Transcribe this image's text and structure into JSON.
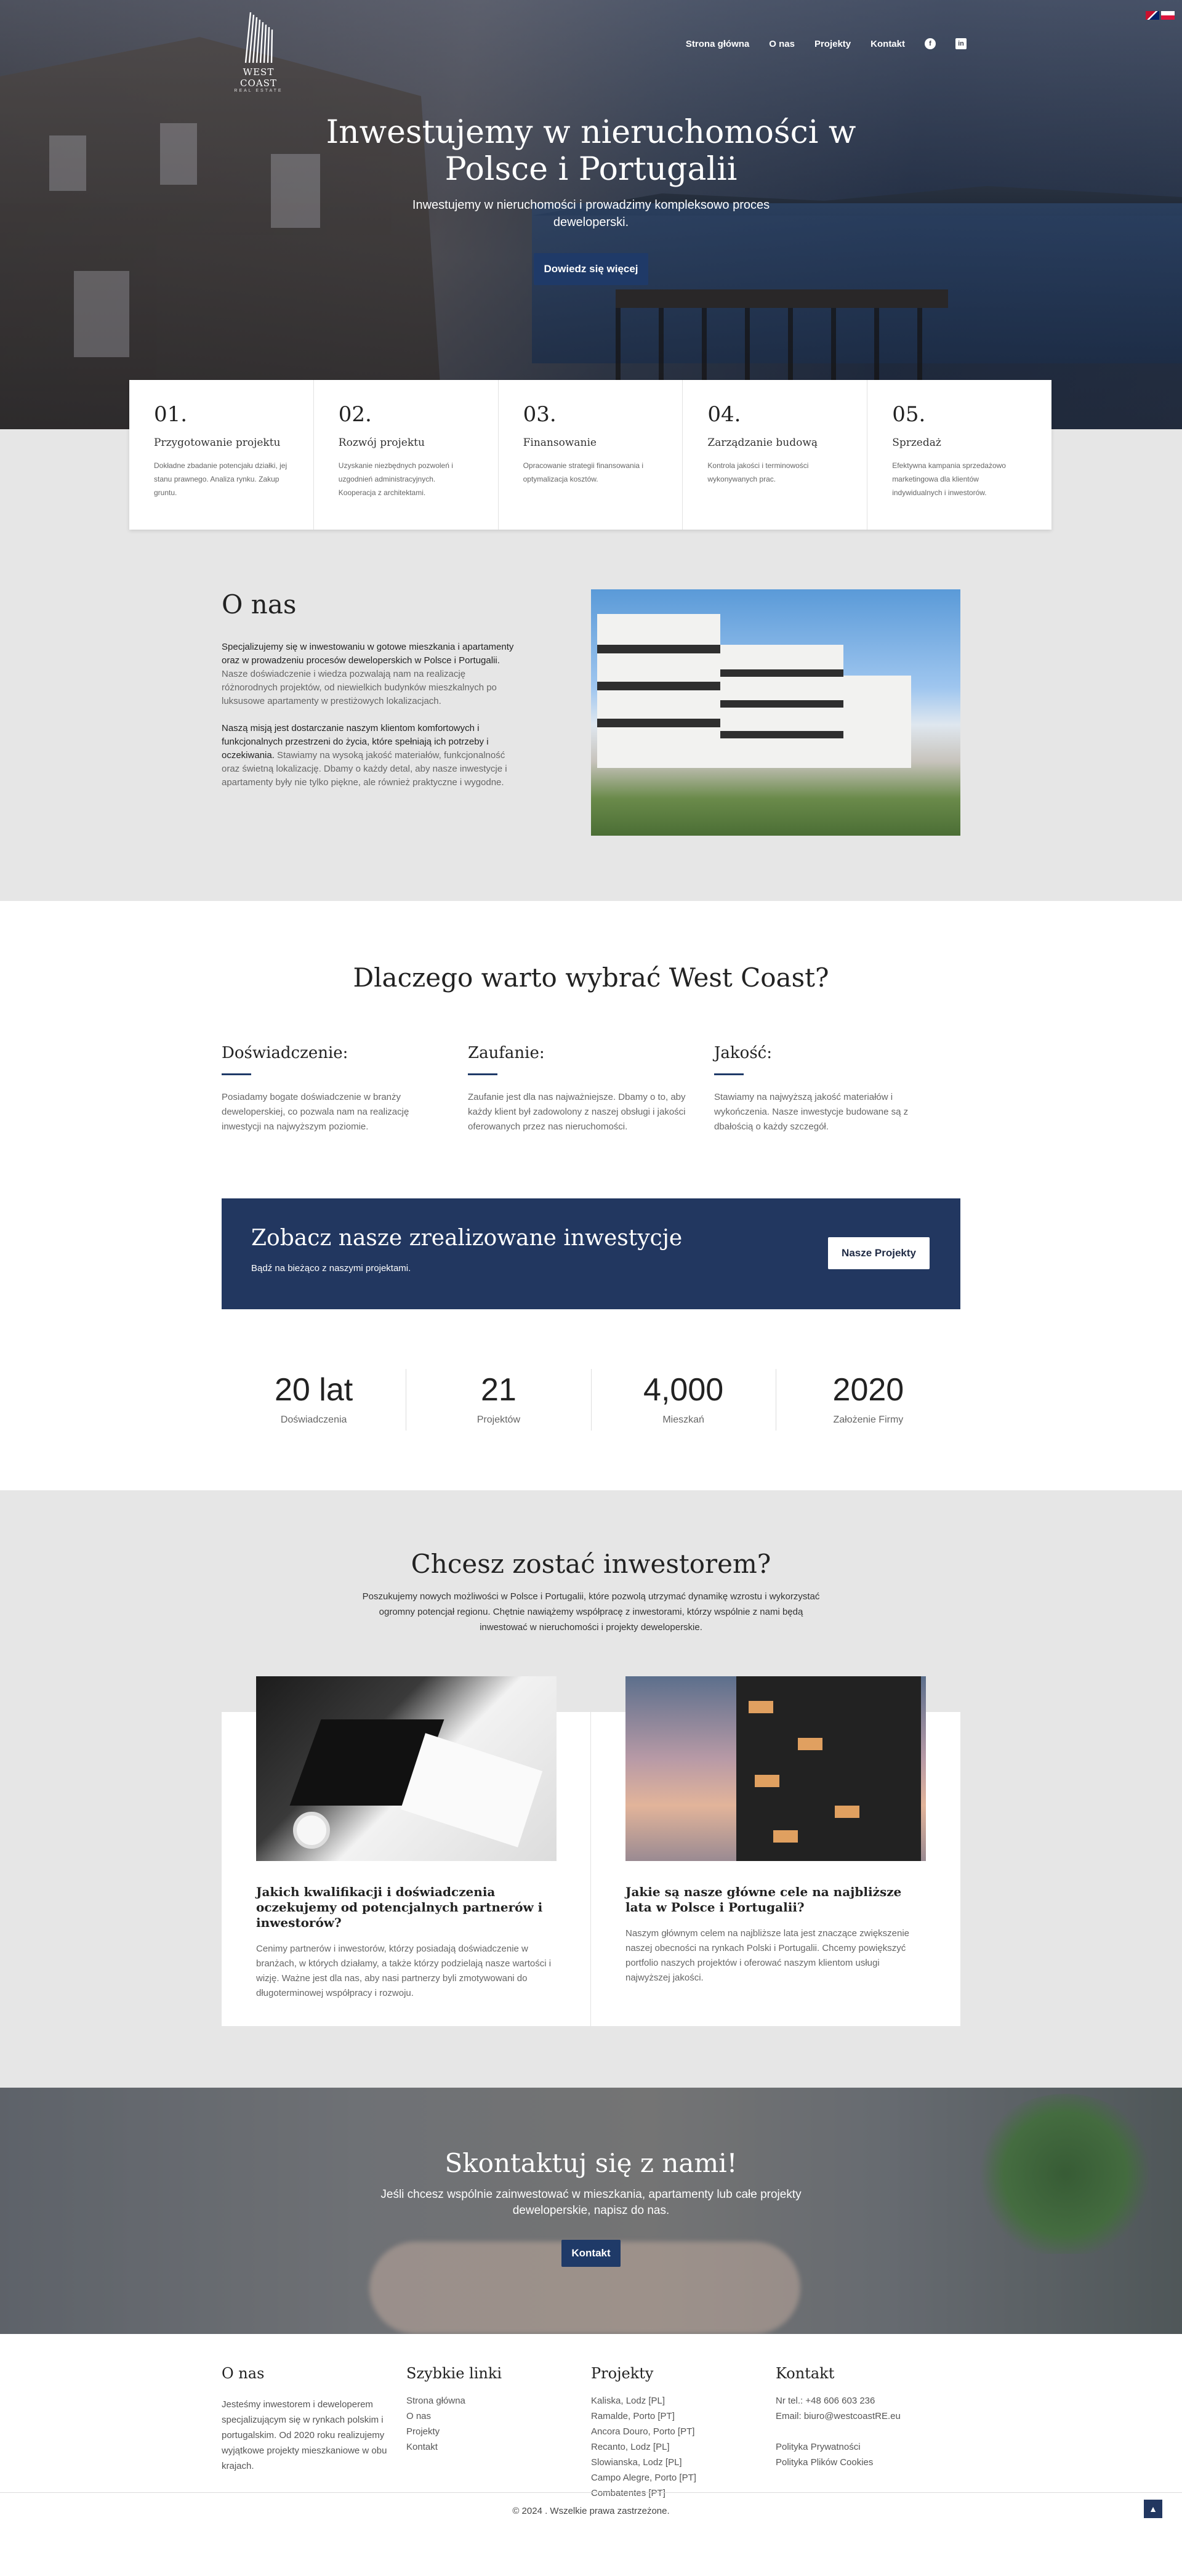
{
  "header": {
    "logo_name": "WEST COAST",
    "logo_sub": "REAL ESTATE",
    "menu": [
      "Strona główna",
      "O nas",
      "Projekty",
      "Kontakt"
    ],
    "social_icons": [
      "facebook-icon",
      "linkedin-icon"
    ],
    "languages": [
      "uk-flag",
      "pl-flag"
    ]
  },
  "hero": {
    "title": "Inwestujemy w nieruchomości w Polsce i Portugalii",
    "subtitle": "Inwestujemy w nieruchomości i prowadzimy kompleksowo proces deweloperski.",
    "button": "Dowiedz się więcej"
  },
  "services": [
    {
      "num": "01.",
      "title": "Przygotowanie projektu",
      "text": "Dokładne zbadanie potencjału działki, jej stanu prawnego. Analiza rynku. Zakup gruntu."
    },
    {
      "num": "02.",
      "title": "Rozwój projektu",
      "text": "Uzyskanie niezbędnych pozwoleń i uzgodnień administracyjnych. Kooperacja z architektami."
    },
    {
      "num": "03.",
      "title": "Finansowanie",
      "text": "Opracowanie strategii finansowania i optymalizacja kosztów."
    },
    {
      "num": "04.",
      "title": "Zarządzanie budową",
      "text": "Kontrola jakości i terminowości wykonywanych prac."
    },
    {
      "num": "05.",
      "title": "Sprzedaż",
      "text": "Efektywna kampania sprzedażowo marketingowa dla klientów indywidualnych i inwestorów."
    }
  ],
  "about": {
    "title": "O nas",
    "p1_strong": "Specjalizujemy się w inwestowaniu w gotowe mieszkania i apartamenty oraz w prowadzeniu procesów deweloperskich w Polsce i Portugalii.",
    "p1_rest": " Nasze doświadczenie i wiedza pozwalają nam na realizację różnorodnych projektów, od niewielkich budynków mieszkalnych po luksusowe apartamenty w prestiżowych lokalizacjach.",
    "p2_strong": "Naszą misją jest dostarczanie naszym klientom komfortowych i funkcjonalnych przestrzeni do życia, które spełniają ich potrzeby i oczekiwania.",
    "p2_rest": " Stawiamy na wysoką jakość materiałów, funkcjonalność oraz świetną lokalizację. Dbamy o każdy detal, aby nasze inwestycje i apartamenty były nie tylko piękne, ale również praktyczne i wygodne."
  },
  "why": {
    "title": "Dlaczego warto wybrać West Coast?",
    "items": [
      {
        "title": "Doświadczenie:",
        "text": "Posiadamy bogate doświadczenie w branży deweloperskiej, co pozwala nam na realizację inwestycji na najwyższym poziomie."
      },
      {
        "title": "Zaufanie:",
        "text": "Zaufanie jest dla nas najważniejsze. Dbamy o to, aby każdy klient był zadowolony z naszej obsługi i jakości oferowanych przez nas nieruchomości."
      },
      {
        "title": "Jakość:",
        "text": "Stawiamy na najwyższą jakość materiałów i wykończenia. Nasze inwestycje budowane są z dbałością o każdy szczegół."
      }
    ]
  },
  "cta": {
    "title": "Zobacz nasze zrealizowane inwestycje",
    "subtitle": "Bądź na bieżąco z naszymi projektami.",
    "button": "Nasze Projekty"
  },
  "stats": [
    {
      "value": "20 lat",
      "label": "Doświadczenia"
    },
    {
      "value": "21",
      "label": "Projektów"
    },
    {
      "value": "4,000",
      "label": "Mieszkań"
    },
    {
      "value": "2020",
      "label": "Założenie Firmy"
    }
  ],
  "investor": {
    "title": "Chcesz zostać inwestorem?",
    "subtitle": "Poszukujemy nowych możliwości w Polsce i Portugalii, które pozwolą utrzymać dynamikę wzrostu i wykorzystać ogromny potencjał regionu. Chętnie nawiążemy współpracę z inwestorami, którzy wspólnie z nami będą inwestować w nieruchomości i projekty deweloperskie.",
    "cards": [
      {
        "title": "Jakich kwalifikacji i doświadczenia oczekujemy od potencjalnych partnerów i inwestorów?",
        "text": "Cenimy partnerów i inwestorów, którzy posiadają doświadczenie w branżach, w których działamy, a także którzy podzielają nasze wartości i wizję. Ważne jest dla nas, aby nasi partnerzy byli zmotywowani do długoterminowej współpracy i rozwoju."
      },
      {
        "title": "Jakie są nasze główne cele na najbliższe lata w Polsce i Portugalii?",
        "text": "Naszym głównym celem na najbliższe lata jest znaczące zwiększenie naszej obecności na rynkach Polski i Portugalii. Chcemy powiększyć portfolio naszych projektów i oferować naszym klientom usługi najwyższej jakości."
      }
    ]
  },
  "contact": {
    "title": "Skontaktuj się z nami!",
    "text": "Jeśli chcesz wspólnie zainwestować w mieszkania, apartamenty lub całe projekty deweloperskie, napisz do nas.",
    "button": "Kontakt"
  },
  "footer": {
    "about_title": "O nas",
    "about_text": "Jesteśmy inwestorem i deweloperem specjalizującym się w rynkach polskim i portugalskim. Od 2020 roku realizujemy wyjątkowe projekty mieszkaniowe w obu krajach.",
    "links_title": "Szybkie linki",
    "links": [
      "Strona główna",
      "O nas",
      "Projekty",
      "Kontakt"
    ],
    "projects_title": "Projekty",
    "projects": [
      "Kaliska, Lodz [PL]",
      "Ramalde, Porto [PT]",
      "Ancora Douro, Porto [PT]",
      "Recanto, Lodz [PL]",
      "Slowianska, Lodz [PL]",
      "Campo Alegre, Porto [PT]",
      "Combatentes [PT]"
    ],
    "contact_title": "Kontakt",
    "phone": "Nr tel.: +48 606 603 236",
    "email": "Email: biuro@westcoastRE.eu",
    "privacy": "Polityka Prywatności",
    "cookies": "Polityka Plików Cookies",
    "copyright": "© 2024 . Wszelkie prawa zastrzeżone."
  }
}
